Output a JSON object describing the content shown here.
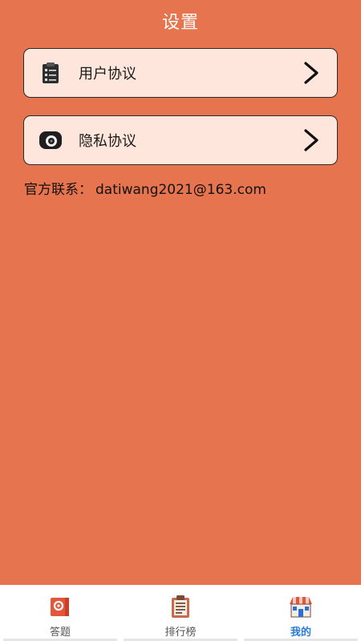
{
  "header": {
    "title": "设置"
  },
  "menu": [
    {
      "label": "用户协议",
      "icon": "clipboard-checklist-icon"
    },
    {
      "label": "隐私协议",
      "icon": "camera-lens-icon"
    }
  ],
  "contact": {
    "label": "官方联系：",
    "email": "datiwang2021@163.com"
  },
  "tabbar": {
    "tabs": [
      {
        "label": "答题",
        "icon": "quiz-book-icon",
        "active": false
      },
      {
        "label": "排行榜",
        "icon": "ranking-clipboard-icon",
        "active": false
      },
      {
        "label": "我的",
        "icon": "shop-house-icon",
        "active": true
      }
    ]
  },
  "colors": {
    "background": "#E6744F",
    "card": "#FFE6DC",
    "active_tab": "#2B7BD8"
  }
}
